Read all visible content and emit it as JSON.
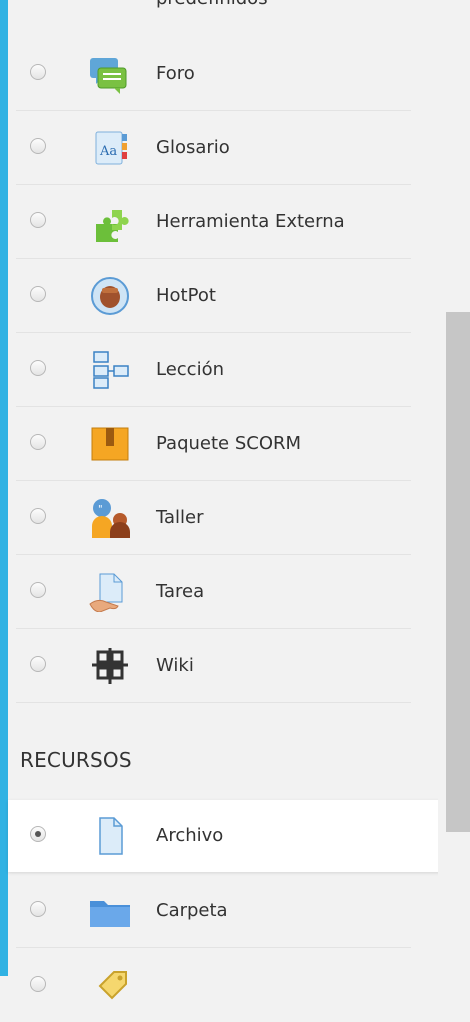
{
  "top_cut_label": "predefinidos",
  "activities": [
    {
      "label": "Foro",
      "icon": "forum-icon",
      "selected": false
    },
    {
      "label": "Glosario",
      "icon": "glossary-icon",
      "selected": false
    },
    {
      "label": "Herramienta Externa",
      "icon": "external-tool-icon",
      "selected": false
    },
    {
      "label": "HotPot",
      "icon": "hotpot-icon",
      "selected": false
    },
    {
      "label": "Lección",
      "icon": "lesson-icon",
      "selected": false
    },
    {
      "label": "Paquete SCORM",
      "icon": "scorm-package-icon",
      "selected": false
    },
    {
      "label": "Taller",
      "icon": "workshop-icon",
      "selected": false
    },
    {
      "label": "Tarea",
      "icon": "assignment-icon",
      "selected": false
    },
    {
      "label": "Wiki",
      "icon": "wiki-icon",
      "selected": false
    }
  ],
  "resources_heading": "RECURSOS",
  "resources": [
    {
      "label": "Archivo",
      "icon": "file-icon",
      "selected": true
    },
    {
      "label": "Carpeta",
      "icon": "folder-icon",
      "selected": false
    },
    {
      "label": "",
      "icon": "tag-icon",
      "selected": false
    }
  ],
  "colors": {
    "accent": "#30b2e3",
    "background": "#f2f2f2",
    "selected_row": "#ffffff",
    "scrollbar_thumb": "#c6c6c6"
  }
}
